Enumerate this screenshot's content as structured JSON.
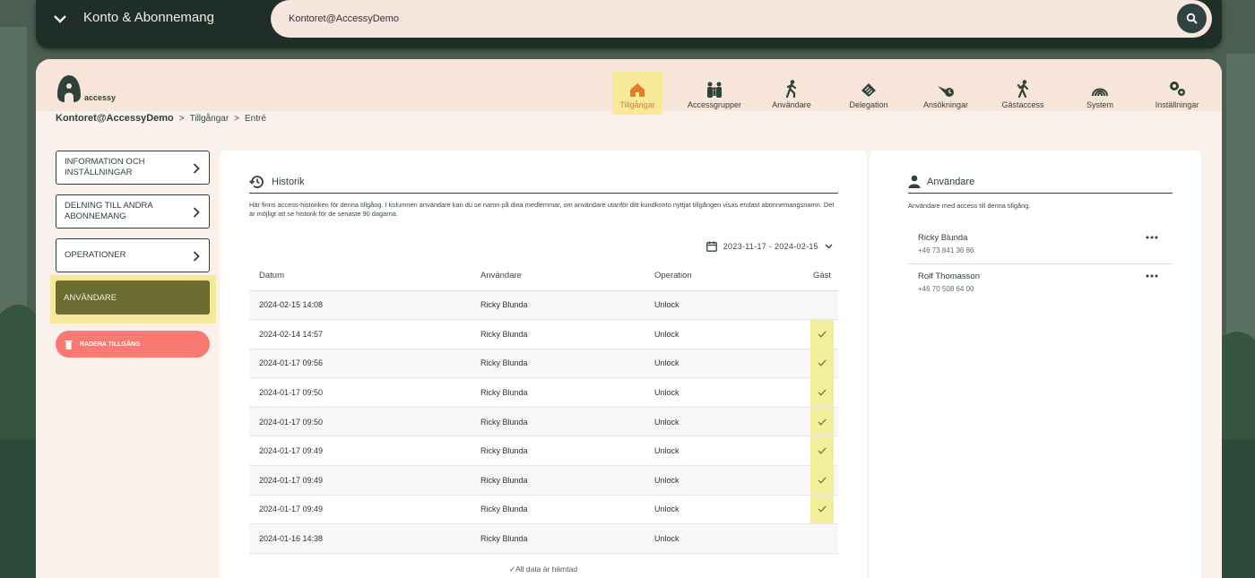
{
  "topbar": {
    "title": "Konto & Abonnemang",
    "search_value": "Kontoret@AccessyDemo"
  },
  "logo": {
    "text": "accessy"
  },
  "nav": [
    {
      "label": "Tillgångar",
      "icon": "house-icon",
      "active": true
    },
    {
      "label": "Accessgrupper",
      "icon": "group-icon",
      "active": false
    },
    {
      "label": "Användare",
      "icon": "walking-person-icon",
      "active": false
    },
    {
      "label": "Delegation",
      "icon": "delegation-icon",
      "active": false
    },
    {
      "label": "Ansökningar",
      "icon": "application-icon",
      "active": false
    },
    {
      "label": "Gästaccess",
      "icon": "guest-icon",
      "active": false
    },
    {
      "label": "System",
      "icon": "fingerprint-icon",
      "active": false
    },
    {
      "label": "Inställningar",
      "icon": "gear-icon",
      "active": false
    }
  ],
  "breadcrumb": {
    "account": "Kontoret@AccessyDemo",
    "sep1": ">",
    "section": "Tillgångar",
    "sep2": ">",
    "item": "Entré"
  },
  "sidebar": {
    "items": [
      {
        "label": "INFORMATION OCH INSTÄLLNINGAR"
      },
      {
        "label": "DELNING TILL ANDRA ABONNEMANG"
      },
      {
        "label": "OPERATIONER"
      }
    ],
    "active": "ANVÄNDARE",
    "delete": "RADERA TILLGÅNG"
  },
  "history": {
    "title": "Historik",
    "description": "Här finns access-historiken för denna tillgång. I kolumnen användare kan du se namn på dina medlemmar, om användare utanför ditt kundkonto nyttjat tillgången visas endast abonnemangsnamn. Det är möjligt att se historik för de senaste 90 dagarna.",
    "daterange": "2023-11-17 - 2024-02-15",
    "columns": [
      "Datum",
      "Användare",
      "Operation",
      "Gäst"
    ],
    "rows": [
      {
        "date": "2024-02-15 14:08",
        "user": "Ricky Blunda",
        "operation": "Unlock",
        "guest": false
      },
      {
        "date": "2024-02-14 14:57",
        "user": "Ricky Blunda",
        "operation": "Unlock",
        "guest": true
      },
      {
        "date": "2024-01-17 09:56",
        "user": "Ricky Blunda",
        "operation": "Unlock",
        "guest": true
      },
      {
        "date": "2024-01-17 09:50",
        "user": "Ricky Blunda",
        "operation": "Unlock",
        "guest": true
      },
      {
        "date": "2024-01-17 09:50",
        "user": "Ricky Blunda",
        "operation": "Unlock",
        "guest": true
      },
      {
        "date": "2024-01-17 09:49",
        "user": "Ricky Blunda",
        "operation": "Unlock",
        "guest": true
      },
      {
        "date": "2024-01-17 09:49",
        "user": "Ricky Blunda",
        "operation": "Unlock",
        "guest": true
      },
      {
        "date": "2024-01-17 09:49",
        "user": "Ricky Blunda",
        "operation": "Unlock",
        "guest": true
      },
      {
        "date": "2024-01-16 14:38",
        "user": "Ricky Blunda",
        "operation": "Unlock",
        "guest": false
      }
    ],
    "loaded": "All data är hämtad"
  },
  "users": {
    "title": "Användare",
    "description": "Användare med access till denna tillgång.",
    "list": [
      {
        "name": "Ricky Blunda",
        "phone": "+46 73 841 36 86"
      },
      {
        "name": "Rolf Thomasson",
        "phone": "+46 70 508 64 00"
      }
    ]
  },
  "colors": {
    "accent": "#e47e2c",
    "dark": "#2f4138",
    "highlight": "#f7e89a",
    "active_side": "#6a6d2f",
    "danger": "#f87a72"
  }
}
